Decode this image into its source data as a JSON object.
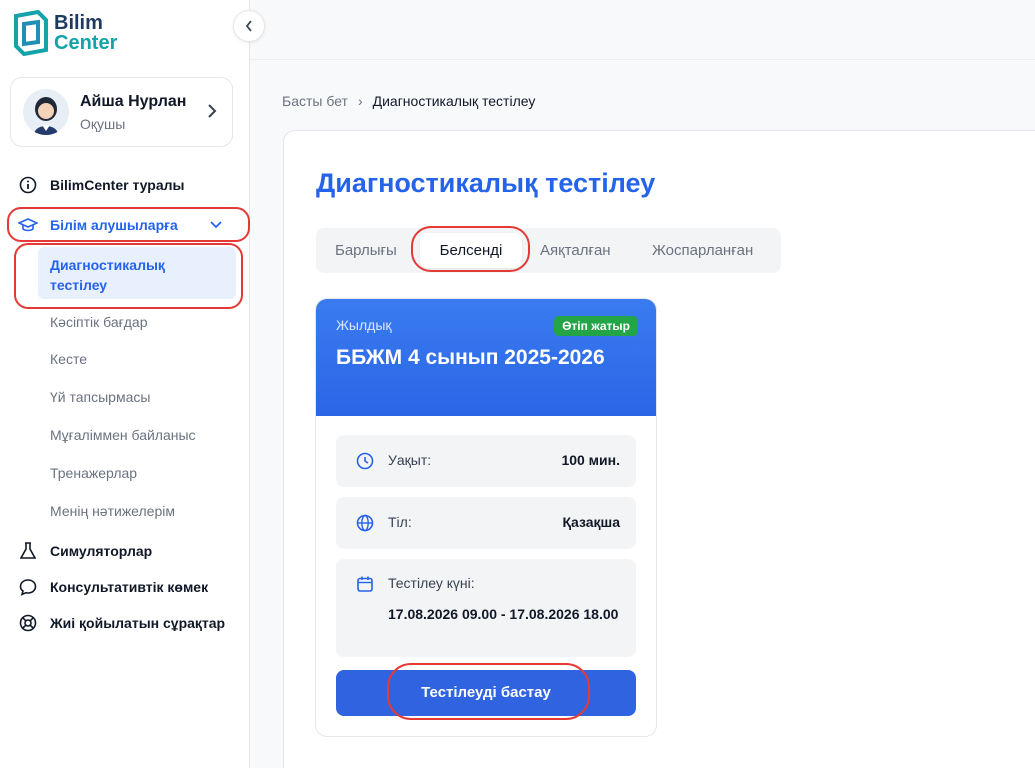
{
  "brand": {
    "line1": "Bilim",
    "line2": "Center"
  },
  "profile": {
    "name": "Айша Нурлан",
    "role": "Оқушы"
  },
  "nav": {
    "about": "BilimCenter туралы",
    "students": "Білім алушыларға",
    "sub_active": "Диагностикалық тестілеу",
    "subs": [
      "Кәсіптік бағдар",
      "Кесте",
      "Үй тапсырмасы",
      "Мұғаліммен байланыс",
      "Тренажерлар",
      "Менің нәтижелерім"
    ],
    "simulators": "Симуляторлар",
    "consult": "Консультативтік көмек",
    "faq": "Жиі қойылатын сұрақтар"
  },
  "breadcrumb": {
    "home": "Басты бет",
    "separator": "›",
    "current": "Диагностикалық тестілеу"
  },
  "page": {
    "title": "Диагностикалық тестілеу"
  },
  "tabs": {
    "all": "Барлығы",
    "active": "Белсенді",
    "done": "Аяқталған",
    "planned": "Жоспарланған"
  },
  "card": {
    "type": "Жылдық",
    "badge": "Өтіп жатыр",
    "title": "ББЖМ 4 сынып 2025-2026",
    "time_label": "Уақыт:",
    "time_value": "100 мин.",
    "lang_label": "Тіл:",
    "lang_value": "Қазақша",
    "date_label": "Тестілеу күні:",
    "date_value": "17.08.2026 09.00 - 17.08.2026 18.00",
    "start_label": "Тестілеуді бастау"
  },
  "colors": {
    "accent": "#2563eb",
    "badge": "#22a447",
    "highlight": "#e53935"
  }
}
